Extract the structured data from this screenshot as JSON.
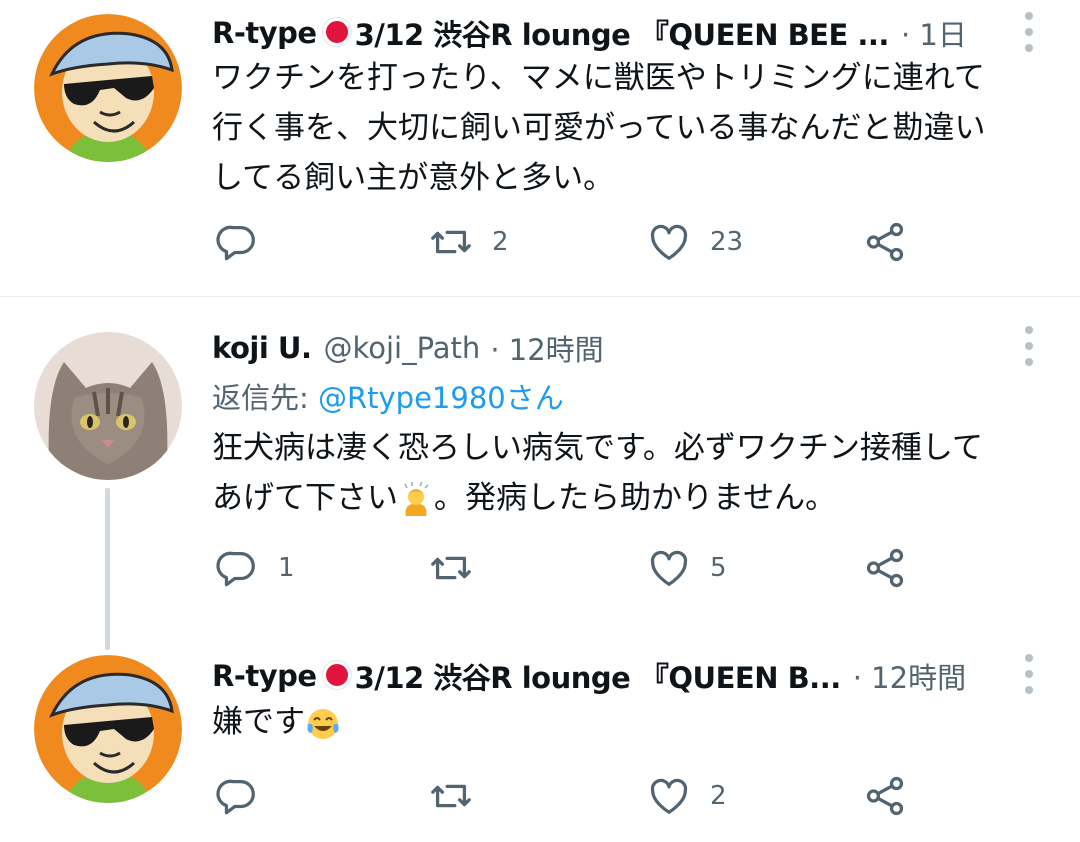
{
  "tweets": [
    {
      "name": "R-type",
      "name_rest": "3/12 渋谷R lounge 『QUEEN BEE ...",
      "time": "· 1日",
      "text_lines": [
        "ワクチンを打ったり、マメに獣医やトリミングに連れて",
        "行く事を、大切に飼い可愛がっている事なんだと勘違い",
        "してる飼い主が意外と多い。"
      ],
      "reply_count": "",
      "retweet_count": "2",
      "like_count": "23"
    },
    {
      "name": "koji U.",
      "handle": "@koji_Path",
      "time": "· 12時間",
      "reply_label": "返信先: ",
      "reply_target": "@Rtype1980さん",
      "text_line1": "狂犬病は凄く恐ろしい病気です。必ずワクチン接種して",
      "text_line2_a": "あげて下さい",
      "text_line2_b": "。発病したら助かりません。",
      "reply_count": "1",
      "retweet_count": "",
      "like_count": "5"
    },
    {
      "name": "R-type",
      "name_rest": "3/12 渋谷R lounge 『QUEEN B...",
      "time": "· 12時間",
      "text": "嫌です",
      "reply_count": "",
      "retweet_count": "",
      "like_count": "2"
    }
  ],
  "icons": [
    "reply-icon",
    "retweet-icon",
    "like-icon",
    "share-icon",
    "more-icon",
    "flag-jp-icon",
    "bowing-emoji-icon",
    "tears-of-joy-emoji-icon"
  ],
  "colors": {
    "text": "#0f1419",
    "secondary": "#536471",
    "link": "#1d9bf0",
    "divider": "#e6ecf0",
    "thread": "#cfd9de"
  }
}
